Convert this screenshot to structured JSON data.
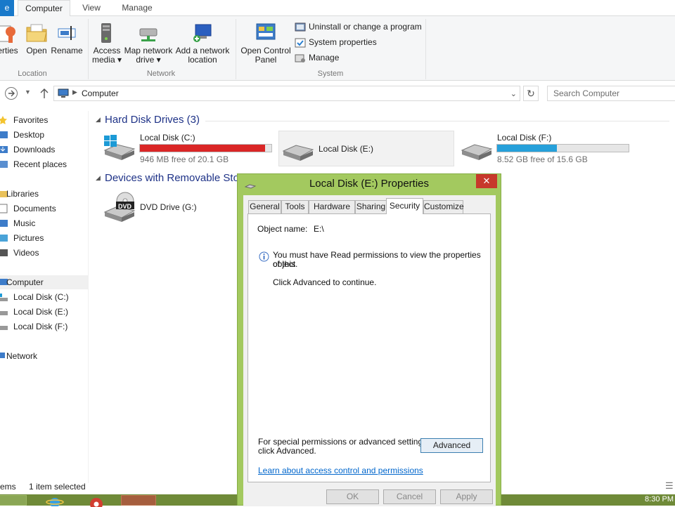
{
  "ribbon_tabs": {
    "file": "e",
    "computer": "Computer",
    "view": "View",
    "manage": "Manage"
  },
  "ribbon": {
    "location_group": "Location",
    "network_group": "Network",
    "system_group": "System",
    "properties_label": "erties",
    "open_label": "Open",
    "rename_label": "Rename",
    "access_media_l1": "Access",
    "access_media_l2": "media ▾",
    "map_drive_l1": "Map network",
    "map_drive_l2": "drive ▾",
    "add_location_l1": "Add a network",
    "add_location_l2": "location",
    "control_panel_l1": "Open Control",
    "control_panel_l2": "Panel",
    "uninstall": "Uninstall or change a program",
    "system_properties": "System properties",
    "manage": "Manage"
  },
  "address": {
    "path": "Computer",
    "search_placeholder": "Search Computer"
  },
  "nav": {
    "favorites": "Favorites",
    "desktop": "Desktop",
    "downloads": "Downloads",
    "recent": "Recent places",
    "libraries": "Libraries",
    "documents": "Documents",
    "music": "Music",
    "pictures": "Pictures",
    "videos": "Videos",
    "computer": "Computer",
    "disk_c": "Local Disk (C:)",
    "disk_e": "Local Disk (E:)",
    "disk_f": "Local Disk (F:)",
    "network": "Network"
  },
  "content": {
    "hdd_heading": "Hard Disk Drives (3)",
    "removable_heading": "Devices with Removable Sto",
    "drive_c": {
      "name": "Local Disk (C:)",
      "free": "946 MB free of 20.1 GB",
      "used_fraction": 0.954
    },
    "drive_e": {
      "name": "Local Disk (E:)"
    },
    "drive_f": {
      "name": "Local Disk (F:)",
      "free": "8.52 GB free of 15.6 GB",
      "used_fraction": 0.454
    },
    "dvd": {
      "name": "DVD Drive (G:)",
      "badge": "DVD"
    }
  },
  "status": {
    "items": "ems",
    "selected": "1 item selected"
  },
  "clock": "8:30 PM",
  "dialog": {
    "title": "Local Disk (E:) Properties",
    "close": "✕",
    "tabs": {
      "general": "General",
      "tools": "Tools",
      "hardware": "Hardware",
      "sharing": "Sharing",
      "security": "Security",
      "customize": "Customize"
    },
    "object_label": "Object name:",
    "object_value": "E:\\",
    "info_line1": "You must have Read permissions to view the properties of this",
    "info_line2": "object.",
    "click_advanced": "Click Advanced to continue.",
    "special_l1": "For special permissions or advanced settings,",
    "special_l2": "click Advanced.",
    "advanced_button": "Advanced",
    "learn_link": "Learn about access control and permissions",
    "ok": "OK",
    "cancel": "Cancel",
    "apply": "Apply"
  },
  "colors": {
    "accent": "#1979ca",
    "drive_c_bar": "#da2626",
    "drive_f_bar": "#26a0da",
    "dialog_frame": "#a3c95f",
    "taskbar": "#6f8a38"
  }
}
